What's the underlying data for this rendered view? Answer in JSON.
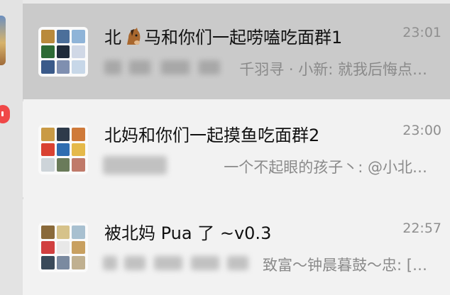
{
  "chats": [
    {
      "title_prefix": "北",
      "title_suffix": "马和你们一起唠嗑吃面群1",
      "time": "23:01",
      "preview": "千羽寻 · 小新: 就我后悔点…",
      "active": true,
      "avatar_colors": [
        "#b98a3c",
        "#4b6f9a",
        "#8fb4d8",
        "#2d6a35",
        "#1f2b3a",
        "#d0d8e6",
        "#3a5a8a",
        "#7f8fb0",
        "#c7d7e8"
      ]
    },
    {
      "title": "北妈和你们一起摸鱼吃面群2",
      "time": "23:00",
      "preview": "一个不起眼的孩子丶: @小北…",
      "active": false,
      "avatar_colors": [
        "#c99a45",
        "#2e3a4a",
        "#cf7a3a",
        "#d94232",
        "#2f6db0",
        "#e5b94a",
        "#cdd4d9",
        "#6a7b5a",
        "#c07a6a"
      ]
    },
    {
      "title": "被北妈 Pua 了 ~v0.3",
      "time": "22:57",
      "preview": "致富～钟晨暮鼓～忠: […",
      "active": false,
      "avatar_colors": [
        "#8a6a3a",
        "#d6c28a",
        "#a8c0d0",
        "#d14040",
        "#e8e8e8",
        "#c8a060",
        "#3a4a5a",
        "#7a8aa0",
        "#c0b090"
      ]
    }
  ],
  "icons": {
    "horse": "horse-face-emoji"
  }
}
